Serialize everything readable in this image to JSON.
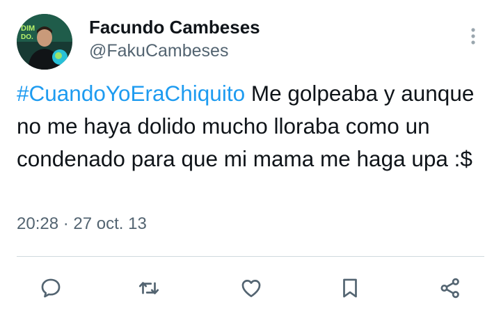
{
  "tweet": {
    "author": {
      "display_name": "Facundo Cambeses",
      "handle": "@FakuCambeses",
      "avatar_icon": "profile-photo"
    },
    "text": {
      "hashtag": "#CuandoYoEraChiquito",
      "body": " Me golpeaba y aunque no me haya dolido mucho lloraba como un condenado para que mi mama me haga upa :$"
    },
    "time": "20:28",
    "separator": " · ",
    "date": "27 oct. 13"
  },
  "colors": {
    "text": "#0f1419",
    "secondary": "#536471",
    "link": "#1d9bf0",
    "divider": "#cfd9de"
  },
  "actions": [
    {
      "name": "reply",
      "icon": "speech-bubble-icon"
    },
    {
      "name": "retweet",
      "icon": "retweet-arrows-icon"
    },
    {
      "name": "like",
      "icon": "heart-icon"
    },
    {
      "name": "bookmark",
      "icon": "bookmark-icon"
    },
    {
      "name": "share",
      "icon": "share-nodes-icon"
    }
  ]
}
